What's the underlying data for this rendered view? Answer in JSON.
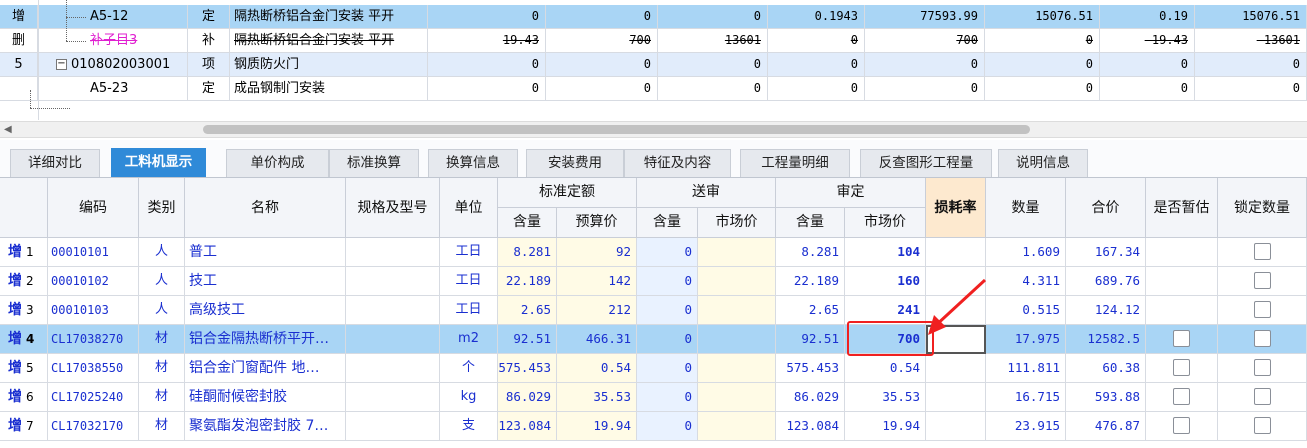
{
  "top_rows": [
    {
      "op": "增",
      "code": "A5-12",
      "type": "定",
      "name": "隔热断桥铝合金门安装 平开",
      "v1": "0",
      "v2": "0",
      "v3": "0",
      "v4": "0.1943",
      "v5": "77593.99",
      "v6": "15076.51",
      "v7": "0.19",
      "v8": "15076.51"
    },
    {
      "op": "删",
      "code": "补子目3",
      "type": "补",
      "name": "隔热断桥铝合金门安装 平开",
      "v1": "19.43",
      "v2": "700",
      "v3": "13601",
      "v4": "0",
      "v5": "700",
      "v6": "0",
      "v7": "-19.43",
      "v8": "-13601"
    },
    {
      "op": "5",
      "code": "010802003001",
      "type": "项",
      "name": "钢质防火门",
      "v1": "0",
      "v2": "0",
      "v3": "0",
      "v4": "0",
      "v5": "0",
      "v6": "0",
      "v7": "0",
      "v8": "0"
    },
    {
      "op": "",
      "code": "A5-23",
      "type": "定",
      "name": "成品钢制门安装",
      "v1": "0",
      "v2": "0",
      "v3": "0",
      "v4": "0",
      "v5": "0",
      "v6": "0",
      "v7": "0",
      "v8": "0"
    }
  ],
  "tree_expander": "−",
  "scroll_arrow": "◀",
  "tabs": [
    "详细对比",
    "工料机显示",
    "单价构成",
    "标准换算",
    "换算信息",
    "安装费用",
    "特征及内容",
    "工程量明细",
    "反查图形工程量",
    "说明信息"
  ],
  "active_tab": "工料机显示",
  "headers": {
    "code": "编码",
    "type": "类别",
    "name": "名称",
    "spec": "规格及型号",
    "unit": "单位",
    "std_group": "标准定额",
    "send_group": "送审",
    "rev_group": "审定",
    "qty_sub": "含量",
    "budget_price": "预算价",
    "market_price": "市场价",
    "loss_rate": "损耗率",
    "quantity": "数量",
    "total": "合价",
    "provisional": "是否暂估",
    "lock_qty": "锁定数量"
  },
  "rows": [
    {
      "op": "增",
      "no": "1",
      "code": "00010101",
      "type": "人",
      "name": "普工",
      "unit": "工日",
      "std_qty": "8.281",
      "std_price": "92",
      "send_qty": "0",
      "send_price": "",
      "rev_qty": "8.281",
      "rev_price": "104",
      "loss": "",
      "qty": "1.609",
      "total": "167.34",
      "provisional": false,
      "has_prov_box": false
    },
    {
      "op": "增",
      "no": "2",
      "code": "00010102",
      "type": "人",
      "name": "技工",
      "unit": "工日",
      "std_qty": "22.189",
      "std_price": "142",
      "send_qty": "0",
      "send_price": "",
      "rev_qty": "22.189",
      "rev_price": "160",
      "loss": "",
      "qty": "4.311",
      "total": "689.76",
      "provisional": false,
      "has_prov_box": false
    },
    {
      "op": "增",
      "no": "3",
      "code": "00010103",
      "type": "人",
      "name": "高级技工",
      "unit": "工日",
      "std_qty": "2.65",
      "std_price": "212",
      "send_qty": "0",
      "send_price": "",
      "rev_qty": "2.65",
      "rev_price": "241",
      "loss": "",
      "qty": "0.515",
      "total": "124.12",
      "provisional": false,
      "has_prov_box": false
    },
    {
      "op": "增",
      "no": "4",
      "code": "CL17038270",
      "type": "材",
      "name": "铝合金隔热断桥平开…",
      "unit": "m2",
      "std_qty": "92.51",
      "std_price": "466.31",
      "send_qty": "0",
      "send_price": "",
      "rev_qty": "92.51",
      "rev_price": "700",
      "loss": "",
      "qty": "17.975",
      "total": "12582.5",
      "provisional": false,
      "has_prov_box": true
    },
    {
      "op": "增",
      "no": "5",
      "code": "CL17038550",
      "type": "材",
      "name": "铝合金门窗配件 地…",
      "unit": "个",
      "std_qty": "575.453",
      "std_price": "0.54",
      "send_qty": "0",
      "send_price": "",
      "rev_qty": "575.453",
      "rev_price": "0.54",
      "loss": "",
      "qty": "111.811",
      "total": "60.38",
      "provisional": false,
      "has_prov_box": true
    },
    {
      "op": "增",
      "no": "6",
      "code": "CL17025240",
      "type": "材",
      "name": "硅酮耐候密封胶",
      "unit": "kg",
      "std_qty": "86.029",
      "std_price": "35.53",
      "send_qty": "0",
      "send_price": "",
      "rev_qty": "86.029",
      "rev_price": "35.53",
      "loss": "",
      "qty": "16.715",
      "total": "593.88",
      "provisional": false,
      "has_prov_box": true
    },
    {
      "op": "增",
      "no": "7",
      "code": "CL17032170",
      "type": "材",
      "name": "聚氨酯发泡密封胶 7…",
      "unit": "支",
      "std_qty": "123.084",
      "std_price": "19.94",
      "send_qty": "0",
      "send_price": "",
      "rev_qty": "123.084",
      "rev_price": "19.94",
      "loss": "",
      "qty": "23.915",
      "total": "476.87",
      "provisional": false,
      "has_prov_box": true
    }
  ],
  "colors": {
    "accent": "#2f8ad8",
    "selected_row": "#a9d5f5",
    "highlight": "#f02020",
    "value_blue": "#1a2fd0",
    "pink": "#e020d0"
  }
}
